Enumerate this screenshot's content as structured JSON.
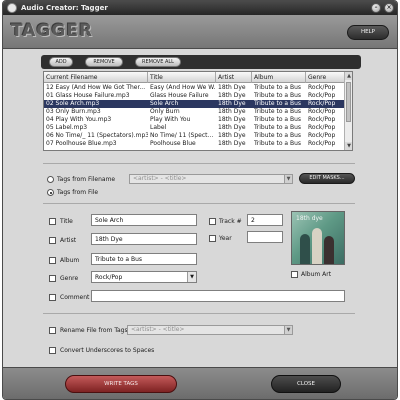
{
  "window": {
    "title": "Audio Creator: Tagger",
    "minimize_glyph": "–",
    "close_glyph": "×"
  },
  "header": {
    "logo": "TAGGER",
    "help_label": "HELP"
  },
  "toolbar": {
    "add_label": "ADD",
    "remove_label": "REMOVE",
    "remove_all_label": "REMOVE ALL"
  },
  "file_list": {
    "columns": [
      "Current Filename",
      "Title",
      "Artist",
      "Album",
      "Genre"
    ],
    "rows": [
      {
        "filename": "12 Easy (And How We Got Ther...",
        "title": "Easy (And How We W...",
        "artist": "18th Dye",
        "album": "Tribute to a Bus",
        "genre": "Rock/Pop",
        "selected": false
      },
      {
        "filename": "01 Glass House Failure.mp3",
        "title": "Glass House Failure",
        "artist": "18th Dye",
        "album": "Tribute to a Bus",
        "genre": "Rock/Pop",
        "selected": false
      },
      {
        "filename": "02 Sole Arch.mp3",
        "title": "Sole Arch",
        "artist": "18th Dye",
        "album": "Tribute to a Bus",
        "genre": "Rock/Pop",
        "selected": true
      },
      {
        "filename": "03 Only Burn.mp3",
        "title": "Only Burn",
        "artist": "18th Dye",
        "album": "Tribute to a Bus",
        "genre": "Rock/Pop",
        "selected": false
      },
      {
        "filename": "04 Play With You.mp3",
        "title": "Play With You",
        "artist": "18th Dye",
        "album": "Tribute to a Bus",
        "genre": "Rock/Pop",
        "selected": false
      },
      {
        "filename": "05 Label.mp3",
        "title": "Label",
        "artist": "18th Dye",
        "album": "Tribute to a Bus",
        "genre": "Rock/Pop",
        "selected": false
      },
      {
        "filename": "06 No Time/_ 11 (Spectators).mp3",
        "title": "No Time/ 11 (Spect...",
        "artist": "18th Dye",
        "album": "Tribute to a Bus",
        "genre": "Rock/Pop",
        "selected": false
      },
      {
        "filename": "07 Poolhouse Blue.mp3",
        "title": "Poolhouse Blue",
        "artist": "18th Dye",
        "album": "Tribute to a Bus",
        "genre": "Rock/Pop",
        "selected": false
      }
    ],
    "scroll_up_glyph": "▲",
    "scroll_down_glyph": "▼"
  },
  "tag_source": {
    "from_filename_label": "Tags from Filename",
    "from_file_label": "Tags from File",
    "selected": "from_file",
    "pattern_value": "<artist> - <title>",
    "edit_masks_label": "EDIT MASKS..."
  },
  "fields": {
    "title_label": "Title",
    "title_value": "Sole Arch",
    "artist_label": "Artist",
    "artist_value": "18th Dye",
    "album_label": "Album",
    "album_value": "Tribute to a Bus",
    "genre_label": "Genre",
    "genre_value": "Rock/Pop",
    "comment_label": "Comment",
    "comment_value": "",
    "track_label": "Track #",
    "track_value": "2",
    "year_label": "Year",
    "year_value": "",
    "album_art_label": "Album Art",
    "album_art_text": "18th dye"
  },
  "rename": {
    "rename_label": "Rename File from Tags",
    "pattern_value": "<artist> - <title>",
    "underscores_label": "Convert Underscores to Spaces"
  },
  "footer": {
    "write_tags_label": "WRITE TAGS",
    "close_label": "CLOSE"
  },
  "colors": {
    "selection": "#2b3760",
    "write_button": "#9e3333"
  }
}
